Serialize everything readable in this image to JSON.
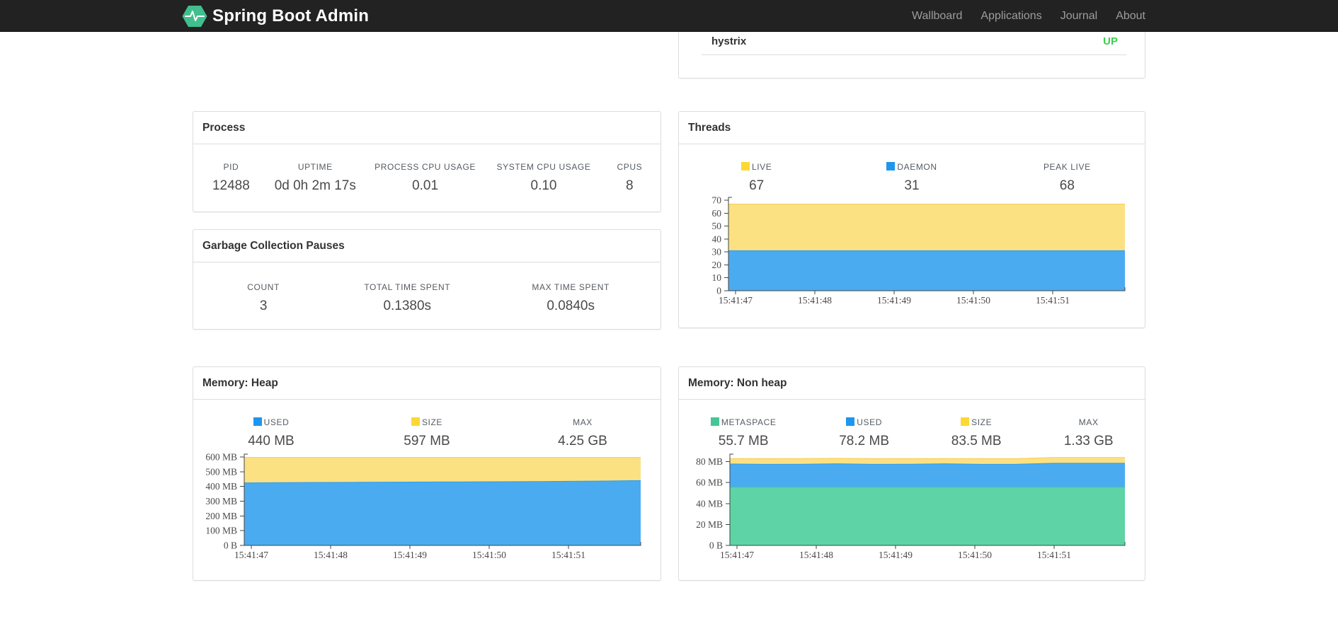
{
  "navbar": {
    "brand": "Spring Boot Admin",
    "items": [
      {
        "label": "Wallboard"
      },
      {
        "label": "Applications"
      },
      {
        "label": "Journal"
      },
      {
        "label": "About"
      }
    ]
  },
  "health": {
    "row_label": "hystrix",
    "status": "UP",
    "status_color": "#3fcd4e"
  },
  "panels": {
    "process": {
      "title": "Process",
      "stats": [
        {
          "label": "PID",
          "value": "12488"
        },
        {
          "label": "UPTIME",
          "value": "0d 0h 2m 17s"
        },
        {
          "label": "PROCESS CPU USAGE",
          "value": "0.01"
        },
        {
          "label": "SYSTEM CPU USAGE",
          "value": "0.10"
        },
        {
          "label": "CPUS",
          "value": "8"
        }
      ]
    },
    "gc": {
      "title": "Garbage Collection Pauses",
      "stats": [
        {
          "label": "COUNT",
          "value": "3"
        },
        {
          "label": "TOTAL TIME SPENT",
          "value": "0.1380s"
        },
        {
          "label": "MAX TIME SPENT",
          "value": "0.0840s"
        }
      ]
    },
    "threads": {
      "title": "Threads",
      "stats": [
        {
          "label": "LIVE",
          "value": "67",
          "swatch": "#fdd835"
        },
        {
          "label": "DAEMON",
          "value": "31",
          "swatch": "#1e96ee"
        },
        {
          "label": "PEAK LIVE",
          "value": "68",
          "swatch": null
        }
      ]
    },
    "heap": {
      "title": "Memory: Heap",
      "stats": [
        {
          "label": "USED",
          "value": "440 MB",
          "swatch": "#1e96ee"
        },
        {
          "label": "SIZE",
          "value": "597 MB",
          "swatch": "#fdd835"
        },
        {
          "label": "MAX",
          "value": "4.25 GB",
          "swatch": null
        }
      ]
    },
    "nonheap": {
      "title": "Memory: Non heap",
      "stats": [
        {
          "label": "METASPACE",
          "value": "55.7 MB",
          "swatch": "#47c596"
        },
        {
          "label": "USED",
          "value": "78.2 MB",
          "swatch": "#1e96ee"
        },
        {
          "label": "SIZE",
          "value": "83.5 MB",
          "swatch": "#fdd835"
        },
        {
          "label": "MAX",
          "value": "1.33 GB",
          "swatch": null
        }
      ]
    }
  },
  "chart_data": [
    {
      "id": "threads",
      "type": "area",
      "title": "Threads",
      "stacked": true,
      "legend_position": "top",
      "grid": false,
      "ylim": [
        0,
        70
      ],
      "x_labels": [
        "15:41:47",
        "15:41:48",
        "15:41:49",
        "15:41:50",
        "15:41:51"
      ],
      "y_ticks": [
        {
          "v": 0,
          "label": "0"
        },
        {
          "v": 10,
          "label": "10"
        },
        {
          "v": 20,
          "label": "20"
        },
        {
          "v": 30,
          "label": "30"
        },
        {
          "v": 40,
          "label": "40"
        },
        {
          "v": 50,
          "label": "50"
        },
        {
          "v": 60,
          "label": "60"
        },
        {
          "v": 70,
          "label": "70"
        }
      ],
      "series": [
        {
          "name": "LIVE",
          "color": "#fce183",
          "line": "#f6ce52",
          "values": [
            67,
            67,
            67,
            67,
            67,
            67,
            67,
            67,
            67,
            67,
            67,
            67
          ]
        },
        {
          "name": "DAEMON",
          "color": "#4babf0",
          "line": "#2b9cf2",
          "values": [
            31,
            31,
            31,
            31,
            31,
            31,
            31,
            31,
            31,
            31,
            31,
            31
          ]
        }
      ]
    },
    {
      "id": "heap",
      "type": "area",
      "title": "Memory: Heap",
      "stacked": false,
      "legend_position": "top",
      "grid": false,
      "ylim": [
        0,
        600
      ],
      "x_labels": [
        "15:41:47",
        "15:41:48",
        "15:41:49",
        "15:41:50",
        "15:41:51"
      ],
      "y_ticks": [
        {
          "v": 0,
          "label": "0 B"
        },
        {
          "v": 100,
          "label": "100 MB"
        },
        {
          "v": 200,
          "label": "200 MB"
        },
        {
          "v": 300,
          "label": "300 MB"
        },
        {
          "v": 400,
          "label": "400 MB"
        },
        {
          "v": 500,
          "label": "500 MB"
        },
        {
          "v": 600,
          "label": "600 MB"
        }
      ],
      "series": [
        {
          "name": "SIZE",
          "color": "#fce183",
          "line": "#f6ce52",
          "values": [
            597,
            597,
            597,
            597,
            597,
            597,
            597,
            597,
            597,
            597,
            597,
            597
          ]
        },
        {
          "name": "USED",
          "color": "#4babf0",
          "line": "#2b9cf2",
          "values": [
            424,
            426,
            427,
            428,
            429,
            430,
            431,
            432,
            433,
            435,
            437,
            440
          ]
        }
      ]
    },
    {
      "id": "nonheap",
      "type": "area",
      "title": "Memory: Non heap",
      "stacked": false,
      "legend_position": "top",
      "grid": false,
      "ylim": [
        0,
        84.5
      ],
      "x_labels": [
        "15:41:47",
        "15:41:48",
        "15:41:49",
        "15:41:50",
        "15:41:51"
      ],
      "y_ticks": [
        {
          "v": 0,
          "label": "0 B"
        },
        {
          "v": 20,
          "label": "20 MB"
        },
        {
          "v": 40,
          "label": "40 MB"
        },
        {
          "v": 60,
          "label": "60 MB"
        },
        {
          "v": 80,
          "label": "80 MB"
        }
      ],
      "series": [
        {
          "name": "SIZE",
          "color": "#fce183",
          "line": "#f6ce52",
          "values": [
            83,
            83,
            83,
            83.2,
            83,
            83,
            83,
            83,
            83,
            84,
            84,
            84
          ]
        },
        {
          "name": "USED",
          "color": "#4babf0",
          "line": "#2b9cf2",
          "values": [
            77.8,
            77.5,
            77.6,
            78,
            77.5,
            77.6,
            78,
            77.5,
            77.6,
            78.5,
            78.5,
            78.5
          ]
        },
        {
          "name": "METASPACE",
          "color": "#5ed3a6",
          "line": "#3ec897",
          "values": [
            55.7,
            55.7,
            55.7,
            55.7,
            55.7,
            55.7,
            55.7,
            55.7,
            55.7,
            55.7,
            55.7,
            55.7
          ]
        }
      ]
    }
  ],
  "colors": {
    "navbar_bg": "#222222",
    "nav_link": "#9d9d9d",
    "logo_green": "#41be8e",
    "panel_border": "#dddddd",
    "status_up": "#3fcd4e",
    "legend_yellow": "#fdd835",
    "legend_blue": "#1e96ee",
    "legend_green": "#47c596"
  }
}
